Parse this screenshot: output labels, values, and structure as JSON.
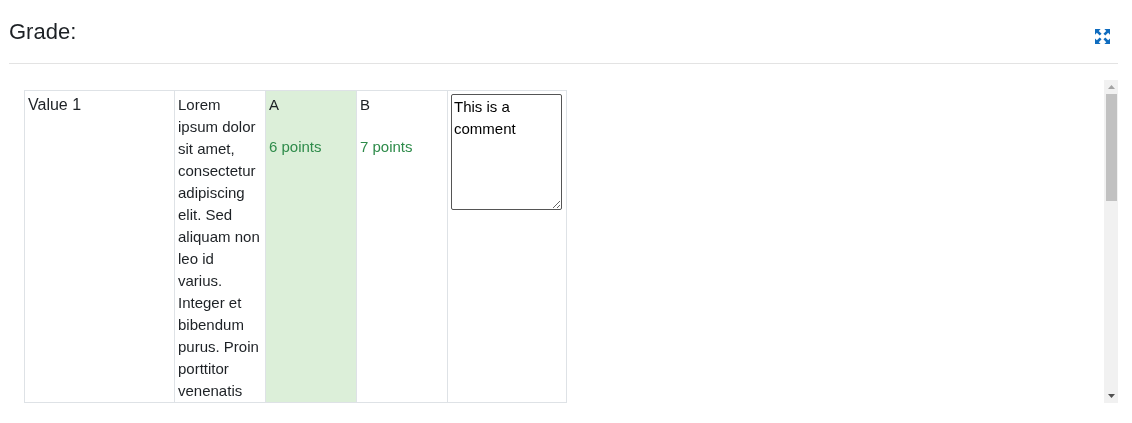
{
  "title": "Grade:",
  "rubric": {
    "criteria": [
      {
        "name": "Value 1",
        "description": "Lorem ipsum dolor sit amet, consectetur adipiscing elit. Sed aliquam non leo id varius. Integer et bibendum purus. Proin porttitor venenatis",
        "levels": [
          {
            "label": "A",
            "points": "6 points",
            "selected": true
          },
          {
            "label": "B",
            "points": "7 points",
            "selected": false
          }
        ],
        "comment": "This is a comment"
      }
    ]
  }
}
